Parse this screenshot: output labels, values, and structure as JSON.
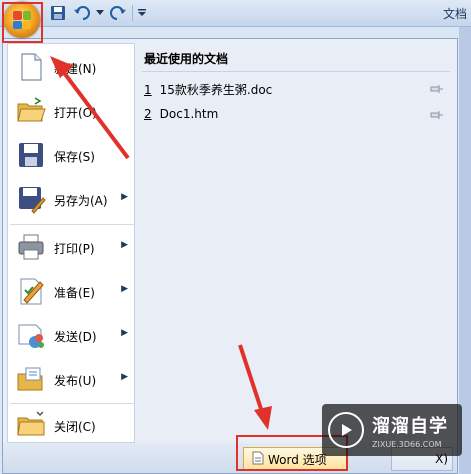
{
  "window": {
    "title": "文档"
  },
  "qat": {
    "undo_icon": "undo-icon",
    "redo_icon": "redo-icon",
    "save_icon": "save-icon"
  },
  "menu": {
    "items": [
      {
        "label": "新建(N)",
        "icon": "new-document-icon",
        "has_submenu": false
      },
      {
        "label": "打开(O)",
        "icon": "open-folder-icon",
        "has_submenu": false
      },
      {
        "label": "保存(S)",
        "icon": "floppy-disk-icon",
        "has_submenu": false
      },
      {
        "label": "另存为(A)",
        "icon": "save-as-icon",
        "has_submenu": true
      },
      {
        "label": "打印(P)",
        "icon": "printer-icon",
        "has_submenu": true
      },
      {
        "label": "准备(E)",
        "icon": "prepare-icon",
        "has_submenu": true
      },
      {
        "label": "发送(D)",
        "icon": "send-icon",
        "has_submenu": true
      },
      {
        "label": "发布(U)",
        "icon": "publish-icon",
        "has_submenu": true
      },
      {
        "label": "关闭(C)",
        "icon": "close-folder-icon",
        "has_submenu": false
      }
    ],
    "recent_title": "最近使用的文档",
    "recent": [
      {
        "num": "1",
        "name": "15款秋季养生粥.doc"
      },
      {
        "num": "2",
        "name": "Doc1.htm"
      }
    ],
    "word_options_label": "Word 选项",
    "exit_label": "X)"
  },
  "watermark": {
    "main": "溜溜自学",
    "sub": "ZIXUE.3D66.COM"
  },
  "colors": {
    "highlight": "#e0312a",
    "accent": "#1e395b"
  }
}
